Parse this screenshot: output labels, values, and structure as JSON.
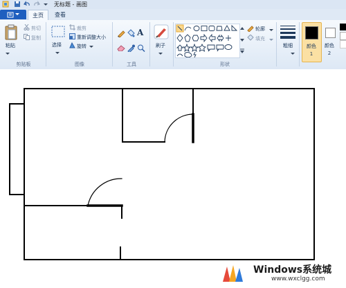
{
  "app": {
    "title": "无标题 - 画图"
  },
  "tabs": {
    "home": "主页",
    "view": "查看"
  },
  "clipboard": {
    "paste": "粘贴",
    "cut": "剪切",
    "copy": "复制",
    "group": "剪贴板"
  },
  "image": {
    "select": "选择",
    "crop": "裁剪",
    "resize": "重新调整大小",
    "rotate": "旋转",
    "group": "图像"
  },
  "tools": {
    "group": "工具",
    "text_tool": "A"
  },
  "brushes": {
    "label": "刷子"
  },
  "shapes": {
    "outline": "轮廓",
    "fill": "填充",
    "group": "形状"
  },
  "size": {
    "label": "粗细"
  },
  "colors": {
    "color1_label": "颜色 1",
    "color2_label": "颜色 2",
    "color1": "#000000",
    "color2": "#ffffff",
    "accent": "#1f5fbf"
  },
  "watermark": {
    "brand": "Windows系统城",
    "url": "www.wxclgg.com"
  }
}
